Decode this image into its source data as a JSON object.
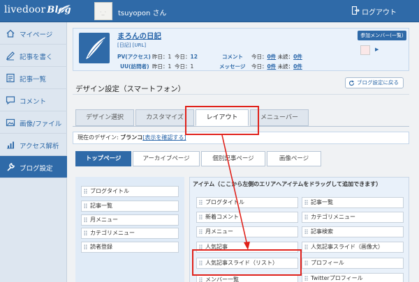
{
  "header": {
    "logo_text": "livedoor",
    "logo_blog": "Blog",
    "username": "tsuyopon さん",
    "logout": "ログアウト"
  },
  "sidebar": {
    "items": [
      {
        "label": "マイページ",
        "icon": "house-icon"
      },
      {
        "label": "記事を書く",
        "icon": "pencil-icon"
      },
      {
        "label": "記事一覧",
        "icon": "list-icon"
      },
      {
        "label": "コメント",
        "icon": "comment-icon"
      },
      {
        "label": "画像/ファイル",
        "icon": "image-icon"
      },
      {
        "label": "アクセス解析",
        "icon": "chart-icon"
      },
      {
        "label": "ブログ設定",
        "icon": "wrench-icon",
        "active": true
      }
    ]
  },
  "blog": {
    "title": "まろんの日記",
    "sub_edit": "[日記]",
    "sub_url": "[URL]",
    "pv_label": "PV(アクセス)",
    "pv_yesterday": "昨日：1",
    "pv_today_label": "今日：",
    "pv_today": "12",
    "uu_label": "UU(訪問者)",
    "uu_yesterday": "昨日：1",
    "uu_today": "今日：1",
    "comment_label": "コメント",
    "comment_today_label": "今日：",
    "comment_today": "0件",
    "comment_unread_label": "未読：",
    "comment_unread": "0件",
    "message_label": "メッセージ",
    "message_today_label": "今日：",
    "message_today": "0件",
    "message_unread_label": "未読：",
    "message_unread": "0件",
    "member_button": "参加メンバー(一覧)"
  },
  "page": {
    "heading": "デザイン設定（スマートフォン）",
    "back_button": "ブログ設定に戻る"
  },
  "tabs": [
    {
      "label": "デザイン選択"
    },
    {
      "label": "カスタマイズ"
    },
    {
      "label": "レイアウト",
      "active": true
    },
    {
      "label": "メニューバー"
    }
  ],
  "current_design": {
    "label": "現在のデザイン:",
    "name": "ブランコ",
    "link": "[表示を確認する]"
  },
  "subtabs": [
    {
      "label": "トップページ",
      "active": true
    },
    {
      "label": "アーカイブページ"
    },
    {
      "label": "個別記事ページ"
    },
    {
      "label": "画像ページ"
    }
  ],
  "layout": {
    "left_items": [
      "ブログタイトル",
      "記事一覧",
      "月メニュー",
      "カテゴリメニュー",
      "読者登録"
    ],
    "right_title": "アイテム（ここから左側のエリアへアイテムをドラッグして追加できます）",
    "right_items_col1": [
      "ブログタイトル",
      "新着コメント",
      "月メニュー",
      "人気記事",
      "人気記事スライド（リスト）",
      "メンバー一覧"
    ],
    "right_items_col2": [
      "記事一覧",
      "カテゴリメニュー",
      "記事検索",
      "人気記事スライド（画像大）",
      "プロフィール",
      "Twitterプロフィール"
    ]
  },
  "annotation_color": "#e0211a",
  "accent_color": "#2f6aa8"
}
